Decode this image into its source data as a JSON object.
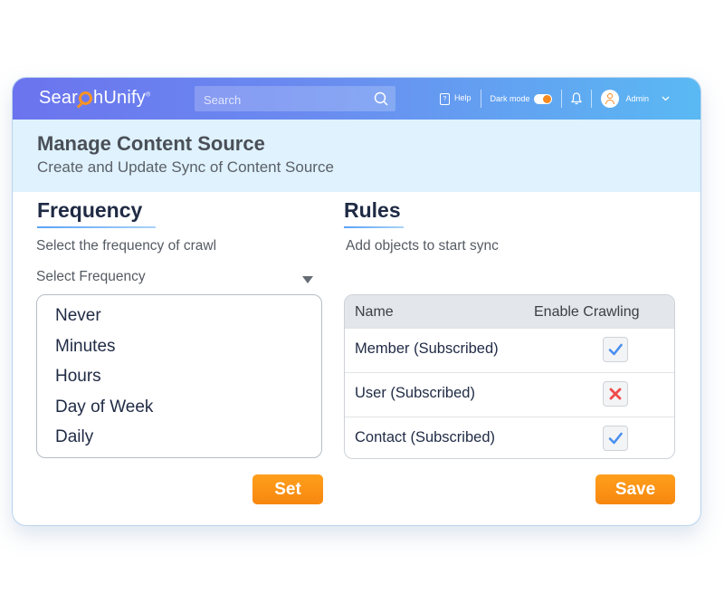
{
  "app": {
    "logo_left": "Sear",
    "logo_right": "hUnify",
    "logo_mark": "®",
    "search_placeholder": "Search",
    "help_label": "Help",
    "dark_mode_label": "Dark mode",
    "dark_mode_on": true,
    "user_name": "Admin"
  },
  "header": {
    "title": "Manage Content Source",
    "subtitle": "Create and Update Sync of Content Source"
  },
  "frequency": {
    "title": "Frequency",
    "description": "Select the frequency of crawl",
    "select_label": "Select Frequency",
    "options": [
      "Never",
      "Minutes",
      "Hours",
      "Day of Week",
      "Daily"
    ],
    "set_button": "Set"
  },
  "rules": {
    "title": "Rules",
    "description": "Add objects to start sync",
    "col_name": "Name",
    "col_enable": "Enable Crawling",
    "rows": [
      {
        "name": "Member (Subscribed)",
        "enabled": true
      },
      {
        "name": "User (Subscribed)",
        "enabled": false
      },
      {
        "name": "Contact (Subscribed)",
        "enabled": true
      }
    ],
    "save_button": "Save"
  },
  "colors": {
    "accent_orange": "#f7891f",
    "check_blue": "#4a8ff0",
    "cross_red": "#ee4b4b",
    "header_bg": "#dff2fd"
  }
}
